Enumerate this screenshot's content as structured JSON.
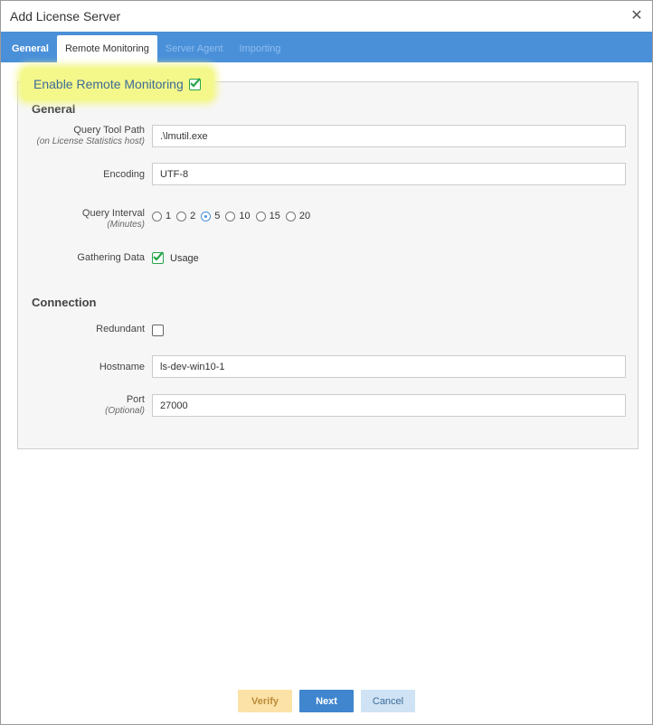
{
  "window": {
    "title": "Add License Server"
  },
  "tabs": [
    {
      "label": "General",
      "state": "normal"
    },
    {
      "label": "Remote Monitoring",
      "state": "active"
    },
    {
      "label": "Server Agent",
      "state": "disabled"
    },
    {
      "label": "Importing",
      "state": "disabled"
    }
  ],
  "remote_monitoring": {
    "enable_label": "Enable Remote Monitoring",
    "enabled": true,
    "general_section": "General",
    "query_tool_path": {
      "label": "Query Tool Path",
      "sub": "(on License Statistics host)",
      "value": ".\\lmutil.exe"
    },
    "encoding": {
      "label": "Encoding",
      "value": "UTF-8"
    },
    "query_interval": {
      "label": "Query Interval",
      "sub": "(Minutes)",
      "options": [
        "1",
        "2",
        "5",
        "10",
        "15",
        "20"
      ],
      "selected": "5"
    },
    "gathering_data": {
      "label": "Gathering Data",
      "option": "Usage",
      "checked": true
    },
    "connection_section": "Connection",
    "redundant": {
      "label": "Redundant",
      "checked": false
    },
    "hostname": {
      "label": "Hostname",
      "value": "ls-dev-win10-1"
    },
    "port": {
      "label": "Port",
      "sub": "(Optional)",
      "value": "27000"
    }
  },
  "footer": {
    "verify": "Verify",
    "next": "Next",
    "cancel": "Cancel"
  },
  "colors": {
    "tab_bar": "#4a90d9",
    "highlight": "#f4f78a",
    "check_green": "#27a44a"
  }
}
